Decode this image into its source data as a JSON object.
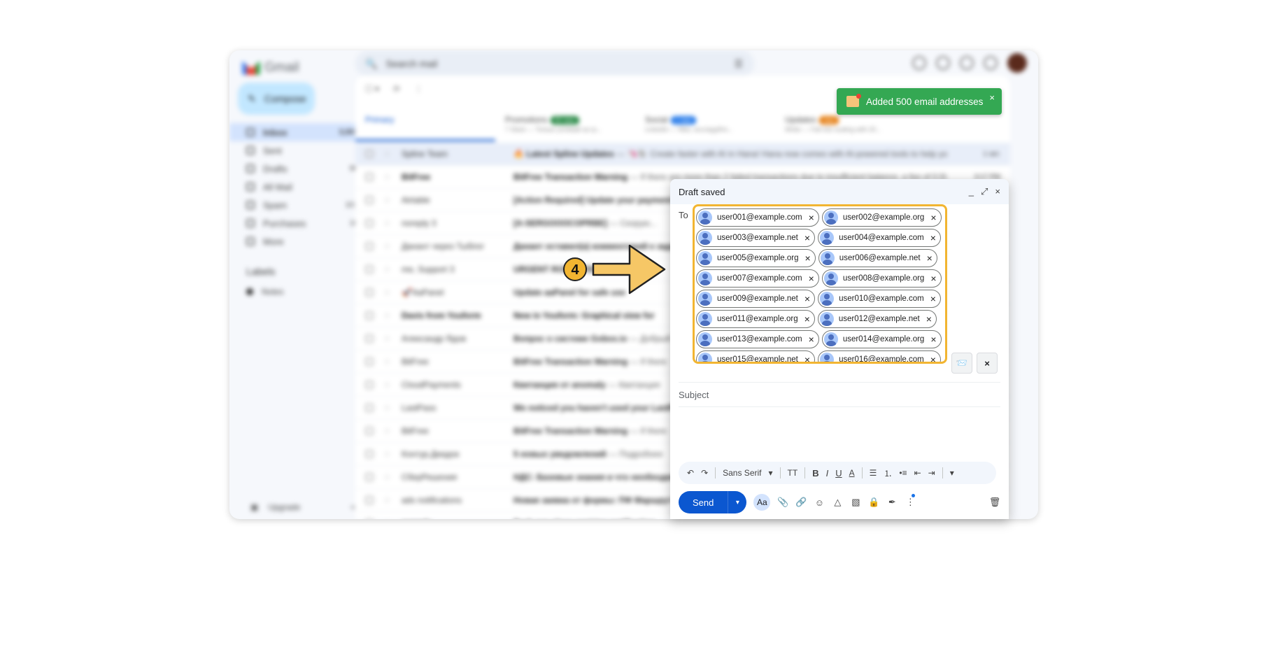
{
  "app": {
    "name": "Gmail",
    "search_placeholder": "Search mail"
  },
  "sidebar": {
    "compose_label": "Compose",
    "items": [
      {
        "label": "Inbox",
        "count": "3,003"
      },
      {
        "label": "Sent",
        "count": ""
      },
      {
        "label": "Drafts",
        "count": "96"
      },
      {
        "label": "All Mail",
        "count": ""
      },
      {
        "label": "Spam",
        "count": "101"
      },
      {
        "label": "Purchases",
        "count": "16"
      },
      {
        "label": "More",
        "count": ""
      }
    ],
    "labels_heading": "Labels",
    "labels": [
      "Notes"
    ],
    "upgrade_label": "Upgrade"
  },
  "tabs": [
    {
      "label": "Primary",
      "sub": "",
      "badge": ""
    },
    {
      "label": "Promotions",
      "sub": "7 Slack — Только успевай за гр...",
      "badge": "50 new"
    },
    {
      "label": "Social",
      "sub": "LinkedIn — Max, исследуйте...",
      "badge": "1 new"
    },
    {
      "label": "Updates",
      "sub": "Wrike — Fall into scaling with 20...",
      "badge": "new"
    }
  ],
  "mail_rows": [
    {
      "from": "Spline Team",
      "subject": "🔥 Latest Spline Updates",
      "preview": " — 🦄🐘 Create faster with AI in Hana! Hana now comes with AI-powered tools to help you gene...",
      "date": "1 окт.",
      "bold": false
    },
    {
      "from": "BitFree",
      "subject": "BitFree Transaction Warning",
      "preview": " — If there are more than 2 failed transactions due to insufficient balance, a fee of 0.5USD...",
      "date": "3:17 PM",
      "bold": true
    },
    {
      "from": "Airtable",
      "subject": "[Action Required] Update your payment",
      "preview": "",
      "date": "",
      "bold": false
    },
    {
      "from": "noreply 3",
      "subject": "[A-SERGOOOCOPRBE]",
      "preview": " — Скорую...",
      "date": "",
      "bold": false
    },
    {
      "from": "Данант через Тыблог",
      "subject": "Данант оставил(а) комментарий к задаче",
      "preview": "",
      "date": "",
      "bold": false
    },
    {
      "from": "me, Support 3",
      "subject": "URGENT ROBOT REPLACEMENT",
      "preview": "",
      "date": "",
      "bold": false
    },
    {
      "from": "🚀AaPanel",
      "subject": "Update aaPanel for safe use",
      "preview": "",
      "date": "",
      "bold": false
    },
    {
      "from": "Davis from Youform",
      "subject": "New in Youform: Graphical view for",
      "preview": "",
      "date": "",
      "bold": true
    },
    {
      "from": "Александр Ядов",
      "subject": "Вопрос о системе Gobox.io",
      "preview": " — Добрый",
      "date": "",
      "bold": false
    },
    {
      "from": "BitFree",
      "subject": "BitFree Transaction Warning",
      "preview": " — If there",
      "date": "",
      "bold": false
    },
    {
      "from": "CloudPayments",
      "subject": "Квитанция от anomaly",
      "preview": " — Квитанция",
      "date": "",
      "bold": false
    },
    {
      "from": "LastPass",
      "subject": "We noticed you haven't used your LastP",
      "preview": "",
      "date": "",
      "bold": false
    },
    {
      "from": "BitFree",
      "subject": "BitFree Transaction Warning",
      "preview": " — If there",
      "date": "",
      "bold": false
    },
    {
      "from": "Контур.Диадок",
      "subject": "5 новых уведомлений",
      "preview": " — Подробнее",
      "date": "",
      "bold": false
    },
    {
      "from": "СберРешения",
      "subject": "НДС: Базовые знания и что необходимо",
      "preview": "",
      "date": "",
      "bold": false
    },
    {
      "from": "ads notifications",
      "subject": "Новая заявка от формы: ПФ Маршрут",
      "preview": "",
      "date": "",
      "bold": false
    },
    {
      "from": "noreply",
      "subject": "flash run place expiring notification",
      "preview": "",
      "date": "",
      "bold": true
    }
  ],
  "toast": {
    "message": "Added 500 email addresses",
    "close": "×"
  },
  "compose": {
    "title": "Draft saved",
    "minimize": "_",
    "expand": "⤢",
    "close": "×",
    "to_label": "To",
    "recipients": [
      [
        "user001@example.com",
        "user002@example.org"
      ],
      [
        "user003@example.net",
        "user004@example.com"
      ],
      [
        "user005@example.org",
        "user006@example.net"
      ],
      [
        "user007@example.com",
        "user008@example.org"
      ],
      [
        "user009@example.net",
        "user010@example.com"
      ],
      [
        "user011@example.org",
        "user012@example.net"
      ],
      [
        "user013@example.com",
        "user014@example.org"
      ],
      [
        "user015@example.net",
        "user016@example.com"
      ]
    ],
    "subject_placeholder": "Subject",
    "format_bar": {
      "font": "Sans Serif",
      "size_icon": "TT",
      "bold": "B",
      "italic": "I",
      "underline": "U",
      "text_color": "A"
    },
    "send_label": "Send",
    "aa_label": "Aa",
    "side_close": "×"
  },
  "annotation": {
    "step": "4",
    "color": "#f2b531"
  }
}
